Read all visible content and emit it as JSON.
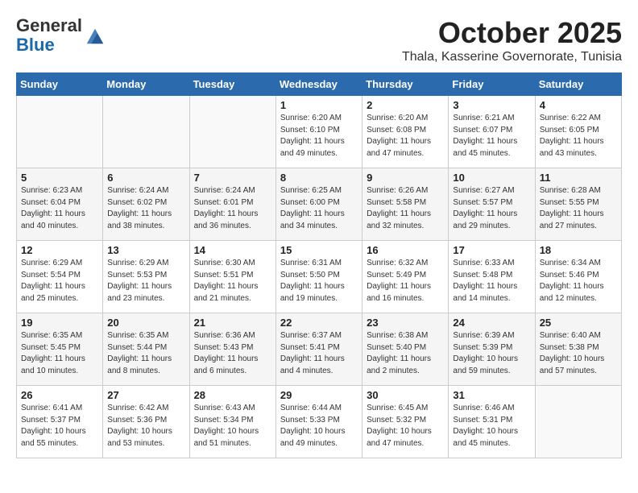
{
  "header": {
    "logo_line1": "General",
    "logo_line2": "Blue",
    "month": "October 2025",
    "location": "Thala, Kasserine Governorate, Tunisia"
  },
  "weekdays": [
    "Sunday",
    "Monday",
    "Tuesday",
    "Wednesday",
    "Thursday",
    "Friday",
    "Saturday"
  ],
  "weeks": [
    [
      {
        "day": "",
        "info": ""
      },
      {
        "day": "",
        "info": ""
      },
      {
        "day": "",
        "info": ""
      },
      {
        "day": "1",
        "info": "Sunrise: 6:20 AM\nSunset: 6:10 PM\nDaylight: 11 hours\nand 49 minutes."
      },
      {
        "day": "2",
        "info": "Sunrise: 6:20 AM\nSunset: 6:08 PM\nDaylight: 11 hours\nand 47 minutes."
      },
      {
        "day": "3",
        "info": "Sunrise: 6:21 AM\nSunset: 6:07 PM\nDaylight: 11 hours\nand 45 minutes."
      },
      {
        "day": "4",
        "info": "Sunrise: 6:22 AM\nSunset: 6:05 PM\nDaylight: 11 hours\nand 43 minutes."
      }
    ],
    [
      {
        "day": "5",
        "info": "Sunrise: 6:23 AM\nSunset: 6:04 PM\nDaylight: 11 hours\nand 40 minutes."
      },
      {
        "day": "6",
        "info": "Sunrise: 6:24 AM\nSunset: 6:02 PM\nDaylight: 11 hours\nand 38 minutes."
      },
      {
        "day": "7",
        "info": "Sunrise: 6:24 AM\nSunset: 6:01 PM\nDaylight: 11 hours\nand 36 minutes."
      },
      {
        "day": "8",
        "info": "Sunrise: 6:25 AM\nSunset: 6:00 PM\nDaylight: 11 hours\nand 34 minutes."
      },
      {
        "day": "9",
        "info": "Sunrise: 6:26 AM\nSunset: 5:58 PM\nDaylight: 11 hours\nand 32 minutes."
      },
      {
        "day": "10",
        "info": "Sunrise: 6:27 AM\nSunset: 5:57 PM\nDaylight: 11 hours\nand 29 minutes."
      },
      {
        "day": "11",
        "info": "Sunrise: 6:28 AM\nSunset: 5:55 PM\nDaylight: 11 hours\nand 27 minutes."
      }
    ],
    [
      {
        "day": "12",
        "info": "Sunrise: 6:29 AM\nSunset: 5:54 PM\nDaylight: 11 hours\nand 25 minutes."
      },
      {
        "day": "13",
        "info": "Sunrise: 6:29 AM\nSunset: 5:53 PM\nDaylight: 11 hours\nand 23 minutes."
      },
      {
        "day": "14",
        "info": "Sunrise: 6:30 AM\nSunset: 5:51 PM\nDaylight: 11 hours\nand 21 minutes."
      },
      {
        "day": "15",
        "info": "Sunrise: 6:31 AM\nSunset: 5:50 PM\nDaylight: 11 hours\nand 19 minutes."
      },
      {
        "day": "16",
        "info": "Sunrise: 6:32 AM\nSunset: 5:49 PM\nDaylight: 11 hours\nand 16 minutes."
      },
      {
        "day": "17",
        "info": "Sunrise: 6:33 AM\nSunset: 5:48 PM\nDaylight: 11 hours\nand 14 minutes."
      },
      {
        "day": "18",
        "info": "Sunrise: 6:34 AM\nSunset: 5:46 PM\nDaylight: 11 hours\nand 12 minutes."
      }
    ],
    [
      {
        "day": "19",
        "info": "Sunrise: 6:35 AM\nSunset: 5:45 PM\nDaylight: 11 hours\nand 10 minutes."
      },
      {
        "day": "20",
        "info": "Sunrise: 6:35 AM\nSunset: 5:44 PM\nDaylight: 11 hours\nand 8 minutes."
      },
      {
        "day": "21",
        "info": "Sunrise: 6:36 AM\nSunset: 5:43 PM\nDaylight: 11 hours\nand 6 minutes."
      },
      {
        "day": "22",
        "info": "Sunrise: 6:37 AM\nSunset: 5:41 PM\nDaylight: 11 hours\nand 4 minutes."
      },
      {
        "day": "23",
        "info": "Sunrise: 6:38 AM\nSunset: 5:40 PM\nDaylight: 11 hours\nand 2 minutes."
      },
      {
        "day": "24",
        "info": "Sunrise: 6:39 AM\nSunset: 5:39 PM\nDaylight: 10 hours\nand 59 minutes."
      },
      {
        "day": "25",
        "info": "Sunrise: 6:40 AM\nSunset: 5:38 PM\nDaylight: 10 hours\nand 57 minutes."
      }
    ],
    [
      {
        "day": "26",
        "info": "Sunrise: 6:41 AM\nSunset: 5:37 PM\nDaylight: 10 hours\nand 55 minutes."
      },
      {
        "day": "27",
        "info": "Sunrise: 6:42 AM\nSunset: 5:36 PM\nDaylight: 10 hours\nand 53 minutes."
      },
      {
        "day": "28",
        "info": "Sunrise: 6:43 AM\nSunset: 5:34 PM\nDaylight: 10 hours\nand 51 minutes."
      },
      {
        "day": "29",
        "info": "Sunrise: 6:44 AM\nSunset: 5:33 PM\nDaylight: 10 hours\nand 49 minutes."
      },
      {
        "day": "30",
        "info": "Sunrise: 6:45 AM\nSunset: 5:32 PM\nDaylight: 10 hours\nand 47 minutes."
      },
      {
        "day": "31",
        "info": "Sunrise: 6:46 AM\nSunset: 5:31 PM\nDaylight: 10 hours\nand 45 minutes."
      },
      {
        "day": "",
        "info": ""
      }
    ]
  ]
}
